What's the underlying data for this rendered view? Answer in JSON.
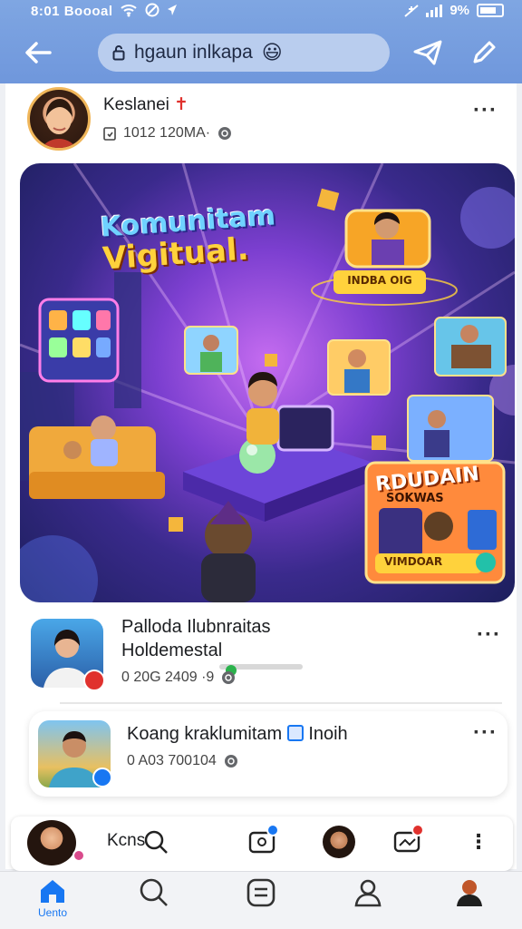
{
  "status_bar": {
    "time": "8:01",
    "carrier": "Boooal",
    "battery": "9%"
  },
  "app_bar": {
    "search_text": "hgaun inlkapa",
    "search_emoji": "😃"
  },
  "post1": {
    "author": "Keslanei",
    "author_flag": "✝",
    "meta": "1012 120MA·"
  },
  "hero": {
    "title_line1": "Komunitam",
    "title_line2": "Vigitual.",
    "banner_sign": "INDBA OIG",
    "promo_title_1": "RDUDAIN",
    "promo_title_2": "SOKWAS",
    "promo_footer": "VIMDOAR"
  },
  "post2": {
    "line1": "Palloda Ilubnraitas",
    "line2": "Holdemestal",
    "meta": "0 20G 2409 ·9"
  },
  "post3": {
    "author": "Koang kraklumitam",
    "tag": "Inoih",
    "meta": "0 A03 700104"
  },
  "composer": {
    "label": "Kcns"
  },
  "bottom_nav": {
    "home_label": "Uento"
  },
  "colors": {
    "brand_blue": "#1877f2",
    "topbar": "#7fa6e2",
    "badge_red": "#e0312d"
  }
}
